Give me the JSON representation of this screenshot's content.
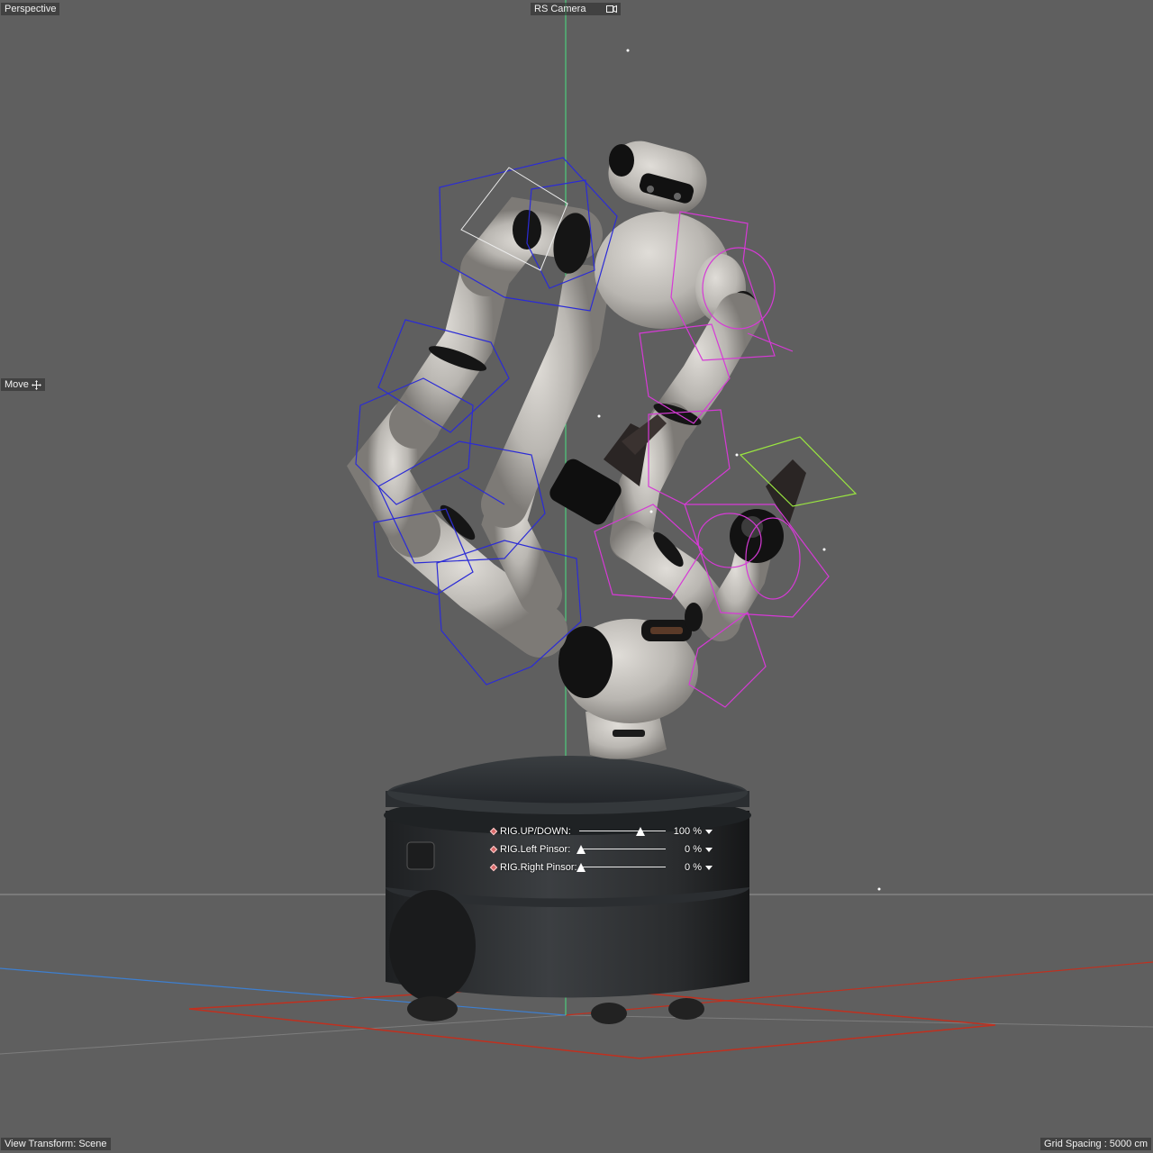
{
  "viewport": {
    "view_name": "Perspective",
    "camera_name": "RS Camera",
    "tool_name": "Move",
    "view_transform": "View Transform: Scene",
    "grid_spacing": "Grid Spacing : 5000 cm"
  },
  "rig_controls": [
    {
      "label": "RIG.UP/DOWN:",
      "value": "100 %",
      "fraction": 1.0
    },
    {
      "label": "RIG.Left Pinsor:",
      "value": "0 %",
      "fraction": 0.0
    },
    {
      "label": "RIG.Right Pinsor:",
      "value": "0 %",
      "fraction": 0.0
    }
  ],
  "colors": {
    "background": "#5f5f5f",
    "left_arm_wire": "#2b2bd6",
    "right_arm_wire": "#d63ad6",
    "gripper_wire": "#9ae640",
    "x_axis": "#c0301f",
    "z_axis": "#3d7fd0",
    "y_axis": "#48e080"
  },
  "icons": {
    "camera": "camera-icon",
    "move": "move-icon",
    "dropdown": "chevron-down-icon"
  }
}
